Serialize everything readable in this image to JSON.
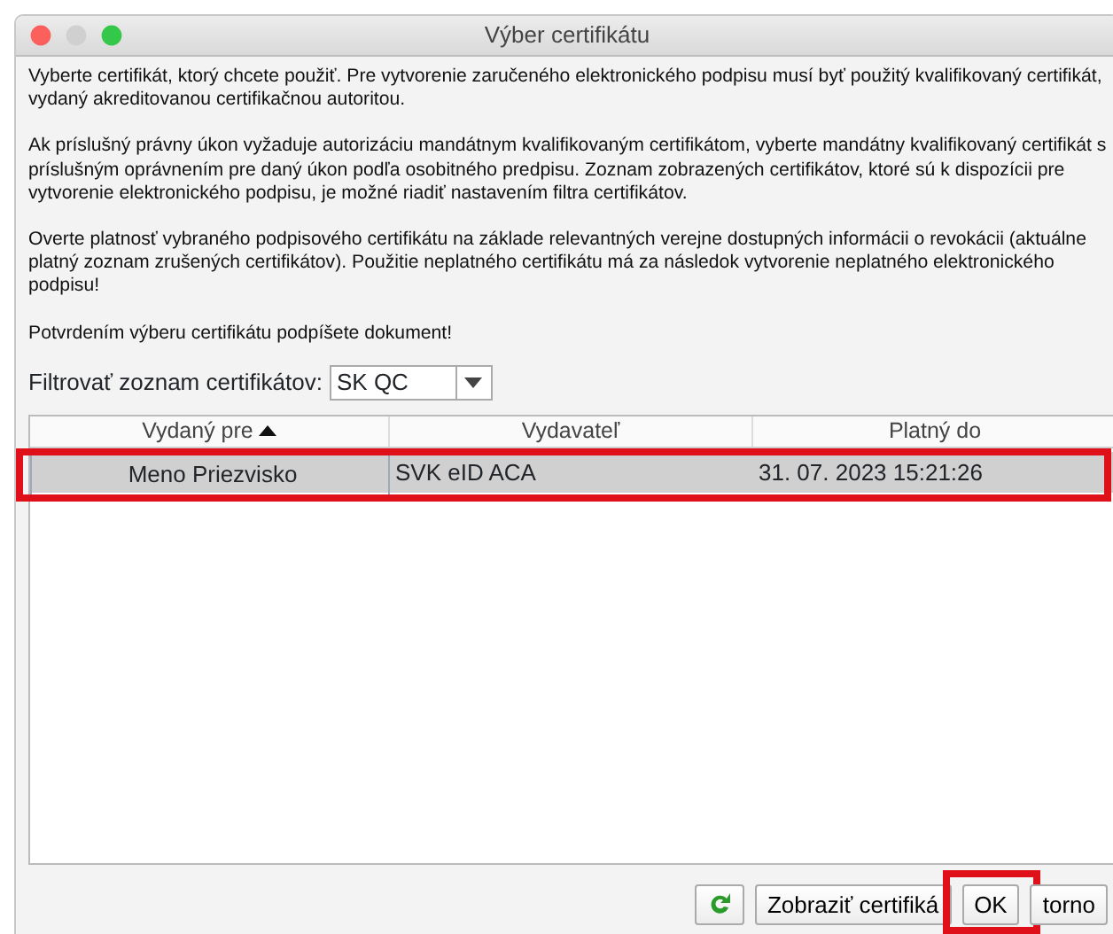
{
  "window": {
    "title": "Výber certifikátu"
  },
  "paragraphs": [
    "Vyberte certifikát, ktorý chcete použiť. Pre vytvorenie zaručeného elektronického podpisu musí byť použitý kvalifikovaný certifikát, vydaný akreditovanou certifikačnou autoritou.",
    "Ak príslušný právny úkon vyžaduje autorizáciu mandátnym kvalifikovaným certifikátom, vyberte mandátny kvalifikovaný certifikát s príslušným oprávnením pre daný úkon podľa osobitného predpisu. Zoznam zobrazených certifikátov, ktoré sú k dispozícii pre vytvorenie elektronického podpisu, je možné riadiť nastavením filtra certifikátov.",
    "Overte platnosť vybraného podpisového certifikátu na základe relevantných verejne dostupných informácii o revokácii (aktuálne platný zoznam zrušených certifikátov). Použitie neplatného certifikátu má za následok vytvorenie neplatného elektronického podpisu!",
    "Potvrdením výberu certifikátu podpíšete dokument!"
  ],
  "filter": {
    "label": "Filtrovať zoznam certifikátov:",
    "value": "SK QC"
  },
  "table": {
    "columns": [
      {
        "label": "Vydaný pre",
        "sorted": true
      },
      {
        "label": "Vydavateľ",
        "sorted": false
      },
      {
        "label": "Platný do",
        "sorted": false
      }
    ],
    "rows": [
      {
        "cells": [
          "Meno Priezvisko",
          "SVK eID ACA",
          "31. 07. 2023 15:21:26"
        ],
        "selected": true,
        "highlighted": true
      }
    ]
  },
  "buttons": [
    {
      "kind": "refresh",
      "highlighted": false
    },
    {
      "kind": "text",
      "label": "Zobraziť certifiká",
      "highlighted": false
    },
    {
      "kind": "text",
      "label": "OK",
      "highlighted": true
    },
    {
      "kind": "text",
      "label": "torno",
      "highlighted": false
    }
  ]
}
